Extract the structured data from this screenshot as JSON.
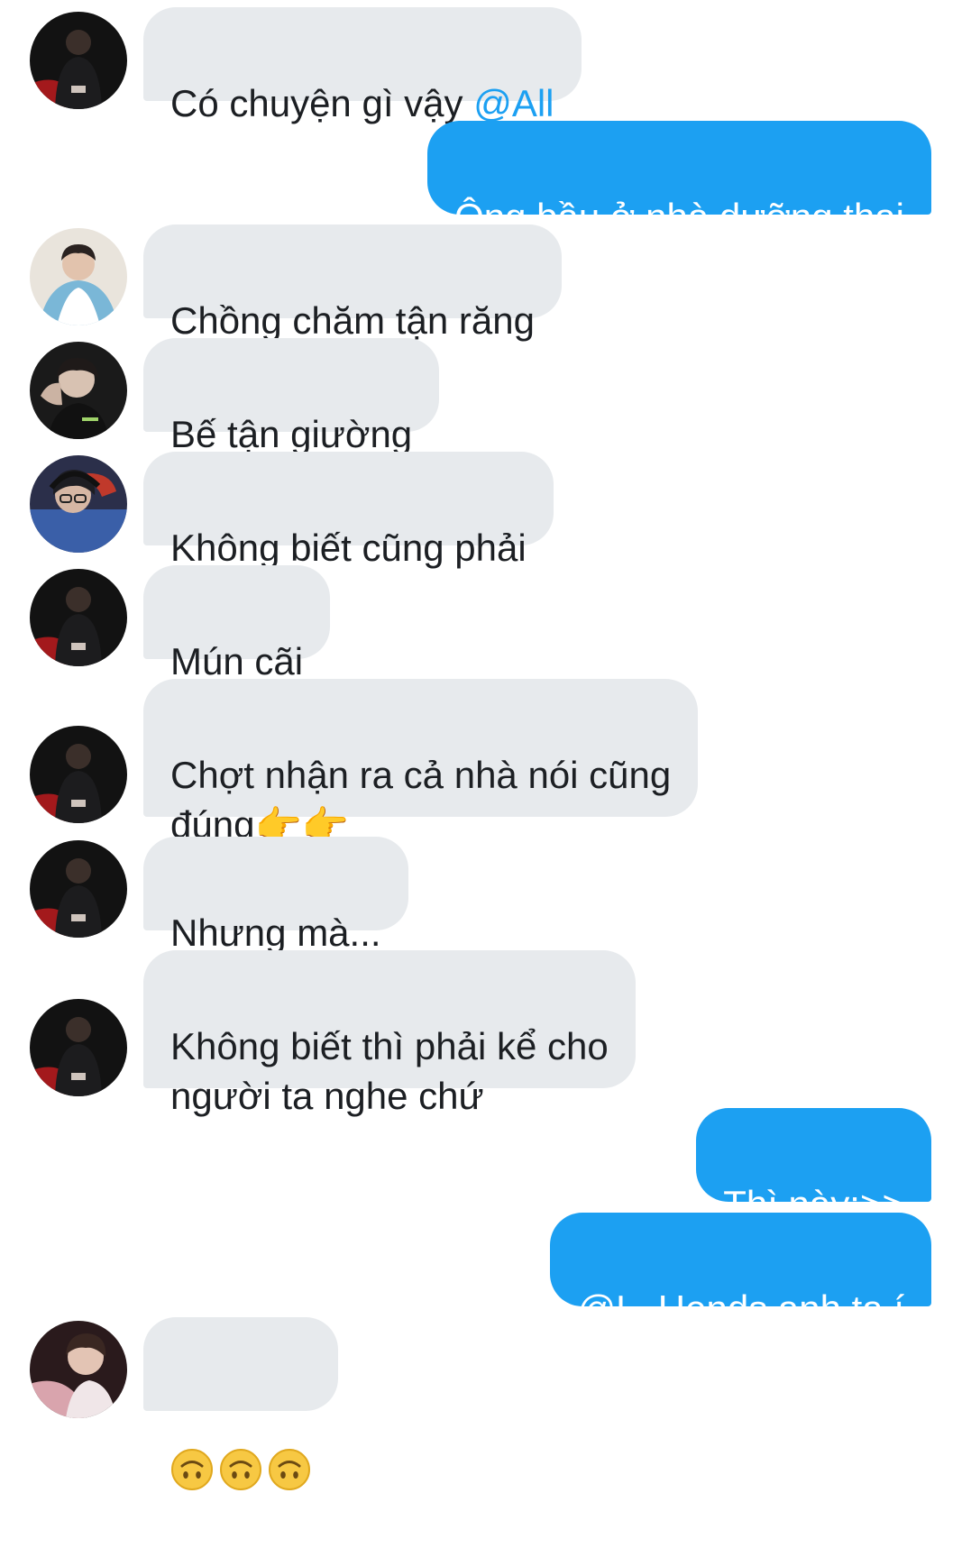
{
  "conversation": {
    "messages": [
      {
        "id": "m1",
        "side": "in",
        "avatar": "avatar-a",
        "text": "Có chuyện gì vậy ",
        "mention": "@All"
      },
      {
        "id": "m2",
        "side": "out",
        "text": "Ông bầu ở nhà dưỡng thai"
      },
      {
        "id": "m3",
        "side": "in",
        "avatar": "avatar-b",
        "text": "Chồng chăm tận răng"
      },
      {
        "id": "m4",
        "side": "in",
        "avatar": "avatar-c",
        "text": "Bế tận giường"
      },
      {
        "id": "m5",
        "side": "in",
        "avatar": "avatar-d",
        "text": "Không biết cũng phải"
      },
      {
        "id": "m6",
        "side": "in",
        "avatar": "avatar-a",
        "text": "Mún cãi"
      },
      {
        "id": "m7",
        "side": "in",
        "avatar": "avatar-a",
        "text": "Chợt nhận ra cả nhà nói cũng\nđúng",
        "emoji": "👉👉"
      },
      {
        "id": "m8",
        "side": "in",
        "avatar": "avatar-a",
        "text": "Nhưng mà..."
      },
      {
        "id": "m9",
        "side": "in",
        "avatar": "avatar-a",
        "text": "Không biết thì phải kể cho\nngười ta nghe chứ"
      },
      {
        "id": "m10",
        "side": "out",
        "text": "Thì này:>>"
      },
      {
        "id": "m11",
        "side": "out",
        "text": "@L_Hends anh ta í"
      },
      {
        "id": "m12",
        "side": "in",
        "avatar": "avatar-e",
        "emoji_icons": [
          "upside-down-face-icon",
          "upside-down-face-icon",
          "upside-down-face-icon"
        ]
      }
    ]
  },
  "colors": {
    "incoming_bubble": "#e7eaed",
    "outgoing_bubble": "#1ca0f2",
    "mention": "#1ca0f2"
  }
}
